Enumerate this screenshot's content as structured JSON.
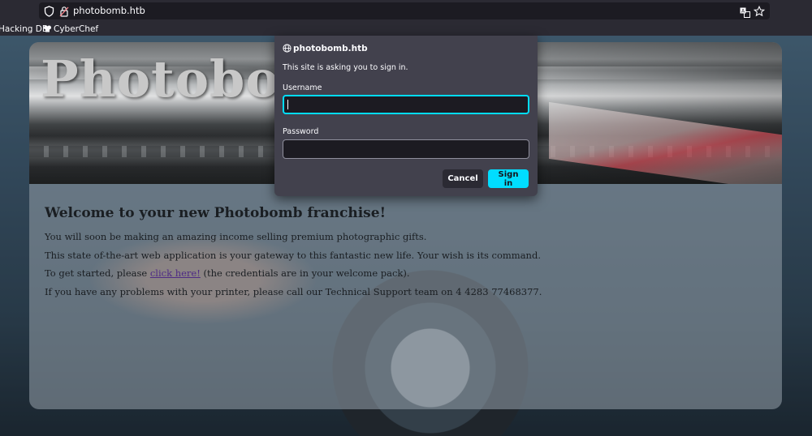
{
  "browser": {
    "url": "photobomb.htb",
    "bookmarks": [
      "Hacking DB",
      "CyberChef"
    ],
    "icons": [
      "shield-icon",
      "lock-icon",
      "translate-icon",
      "star-icon",
      "cyberchef-icon"
    ]
  },
  "page": {
    "banner_title": "Photobomb",
    "heading": "Welcome to your new Photobomb franchise!",
    "line1": "You will soon be making an amazing income selling premium photographic gifts.",
    "line2": "This state of-the-art web application is your gateway to this fantastic new life. Your wish is its command.",
    "line3_before": "To get started, please ",
    "line3_link": "click here!",
    "line3_after": " (the credentials are in your welcome pack).",
    "line4": "If you have any problems with your printer, please call our Technical Support team on 4 4283 77468377."
  },
  "auth_dialog": {
    "origin": "photobomb.htb",
    "message": "This site is asking you to sign in.",
    "username_label": "Username",
    "username_value": "",
    "password_label": "Password",
    "password_value": "",
    "cancel_label": "Cancel",
    "signin_label": "Sign in"
  },
  "colors": {
    "accent": "#00ddff",
    "dialog_bg": "#42414d",
    "chrome_bg": "#2b2a33",
    "link": "#4e2a84"
  }
}
